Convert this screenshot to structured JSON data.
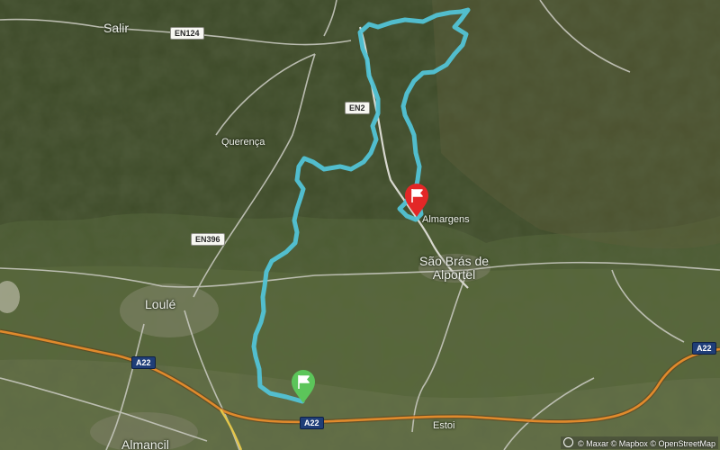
{
  "map": {
    "places": {
      "salir": "Salir",
      "querenca": "Querença",
      "loule": "Loulé",
      "almargens": "Almargens",
      "sao_bras_line1": "São Brás de",
      "sao_bras_line2": "Alportel",
      "estoi": "Estoi",
      "almancil": "Almancil"
    },
    "road_labels": {
      "en124": "EN124",
      "en2": "EN2",
      "en396": "EN396",
      "a22_west": "A22",
      "a22_south": "A22",
      "a22_east": "A22"
    },
    "route_color": "#52c3d6",
    "start_marker_color": "#5cc55a",
    "finish_marker_color": "#e32727",
    "attribution": {
      "maxar": "© Maxar",
      "mapbox": "© Mapbox",
      "osm": "© OpenStreetMap"
    }
  }
}
